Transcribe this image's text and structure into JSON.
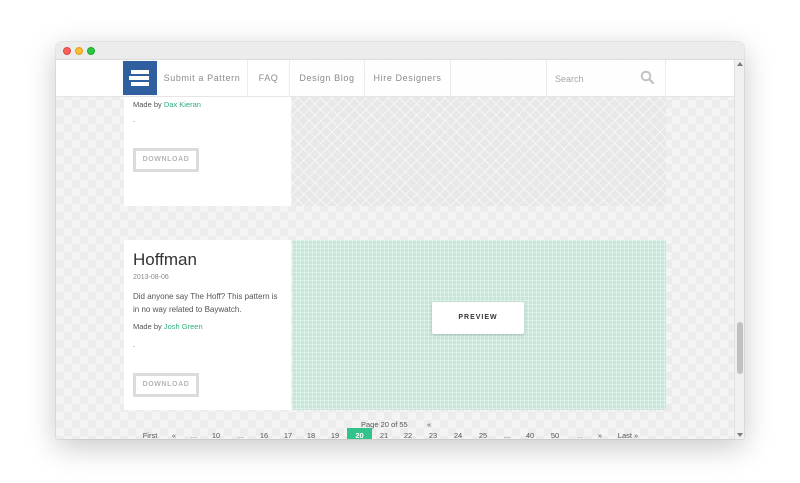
{
  "nav": {
    "items": [
      "Submit a Pattern",
      "FAQ",
      "Design Blog",
      "Hire Designers"
    ],
    "search_placeholder": "Search"
  },
  "cards": [
    {
      "made_by_prefix": "Made by",
      "author": "Dax Kieran",
      "dot": ".",
      "download_label": "DOWNLOAD"
    },
    {
      "title": "Hoffman",
      "date": "2013-08-06",
      "description": "Did anyone say The Hoff? This pattern is in no way related to Baywatch.",
      "made_by_prefix": "Made by",
      "author": "Josh Green",
      "dot": ".",
      "download_label": "DOWNLOAD",
      "preview_label": "PREVIEW"
    }
  ],
  "pagination": {
    "label": "Page 20 of 55",
    "top_prev": "«",
    "first": "First",
    "prev": "«",
    "ellipsis": "...",
    "pages": [
      "10",
      "...",
      "16",
      "17",
      "18",
      "19",
      "20",
      "21",
      "22",
      "23",
      "24",
      "25",
      "...",
      "40",
      "50",
      "...",
      "»",
      "Last »"
    ],
    "current": "20"
  },
  "colors": {
    "accent": "#33c289",
    "link": "#2cae7a",
    "logo": "#2f5f9e",
    "preview_bg": "#c5e6d8"
  }
}
